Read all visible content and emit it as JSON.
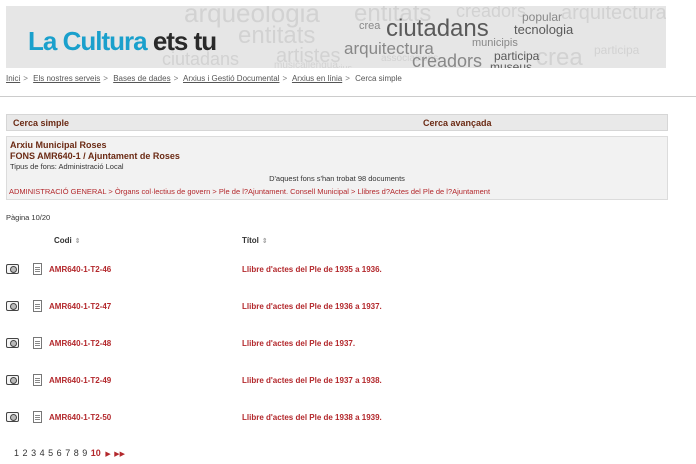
{
  "banner": {
    "logo_part1": "La Cultura",
    "logo_part2": "ets tu",
    "words": [
      "crea",
      "ciutadans",
      "popular",
      "tecnologia",
      "municipis",
      "arquitectura",
      "creadors",
      "participa",
      "museus",
      "arqueologia",
      "entitats",
      "creadors",
      "arquitectura",
      "associacions",
      "musicallengua",
      "ciutadans",
      "artistes",
      "participa",
      "xius",
      "crea",
      "entitats"
    ]
  },
  "breadcrumb": {
    "items": [
      "Inici",
      "Els nostres serveis",
      "Bases de dades",
      "Arxius i Gestió Documental",
      "Arxius en línia"
    ],
    "current": "Cerca simple",
    "separator": ">"
  },
  "tabs": {
    "simple": "Cerca simple",
    "advanced": "Cerca avançada"
  },
  "fonds": {
    "archive": "Arxiu Municipal Roses",
    "title": "FONS AMR640-1 / Ajuntament de Roses",
    "type_label": "Tipus de fons: Administració Local",
    "found_text": "D'aquest fons s'han trobat 98 documents",
    "path": [
      "ADMINISTRACIÓ GENERAL",
      "Òrgans col·lectius de govern",
      "Ple de l?Ajuntament. Consell Municipal",
      "Llibres d?Actes del Ple de l?Ajuntament"
    ]
  },
  "results": {
    "page_info": "Pàgina 10/20",
    "headers": {
      "code": "Codi",
      "title": "Títol"
    },
    "rows": [
      {
        "code": "AMR640-1-T2-46",
        "title": "Llibre d'actes del Ple de 1935 a 1936."
      },
      {
        "code": "AMR640-1-T2-47",
        "title": "Llibre d'actes del Ple de 1936 a 1937."
      },
      {
        "code": "AMR640-1-T2-48",
        "title": "Llibre d'actes del Ple de 1937."
      },
      {
        "code": "AMR640-1-T2-49",
        "title": "Llibre d'actes del Ple de 1937 a 1938."
      },
      {
        "code": "AMR640-1-T2-50",
        "title": "Llibre d'actes del Ple de 1938 a 1939."
      }
    ]
  },
  "pagination": {
    "pages": [
      "1",
      "2",
      "3",
      "4",
      "5",
      "6",
      "7",
      "8",
      "9",
      "10"
    ],
    "current": "10",
    "next": "▶",
    "last": "▶▶"
  },
  "colors": {
    "accent_red": "#b3282c",
    "title_brown": "#6b2a14",
    "logo_blue": "#1aa0cc"
  },
  "icons": {
    "camera": "camera-icon",
    "document": "document-icon",
    "sort": "sort-icon"
  }
}
